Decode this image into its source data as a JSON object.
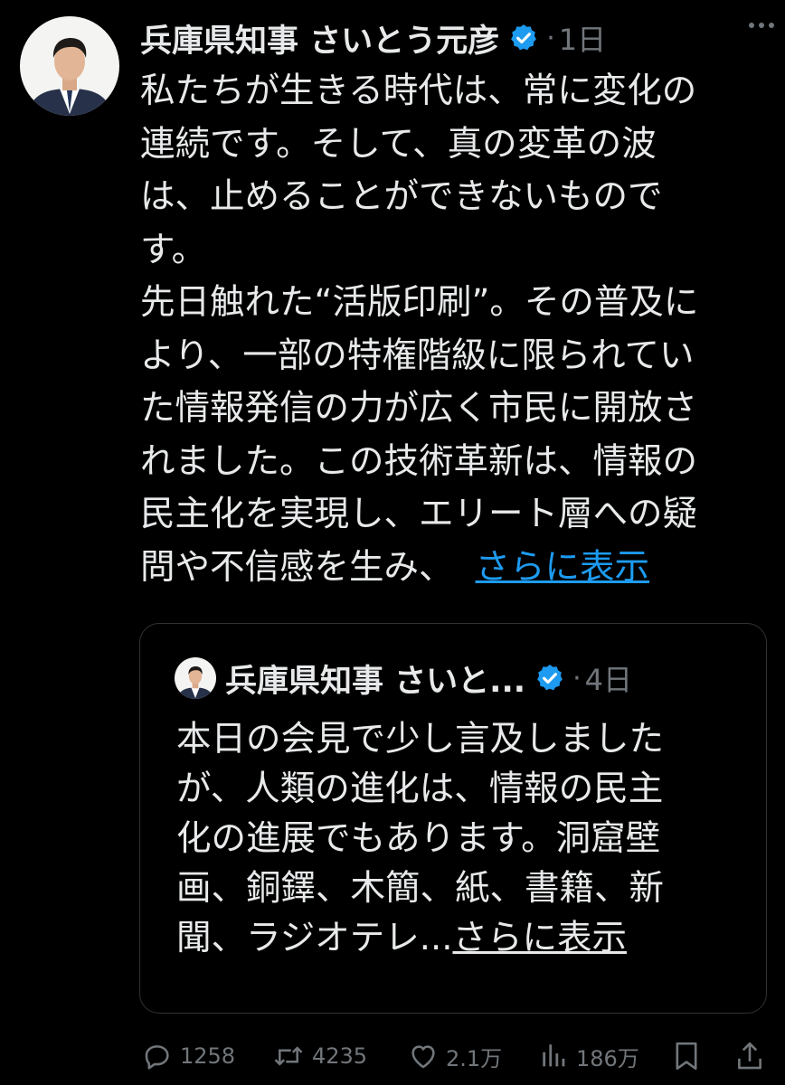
{
  "post": {
    "author": "兵庫県知事 さいとう元彦",
    "time": "1日",
    "dot": "·",
    "paragraph1": [
      "私たちが生きる時代は、常に変化の",
      "連続です。そして、真の変革の波",
      "は、止めることができないもので",
      "す。"
    ],
    "paragraph2": [
      "先日触れた“活版印刷”。その普及に",
      "より、一部の特権階級に限られてい",
      "た情報発信の力が広く市民に開放さ",
      "れました。この技術革新は、情報の",
      "民主化を実現し、エリート層への疑"
    ],
    "last_line": "問や不信感を生み、",
    "show_more": "さらに表示"
  },
  "quote": {
    "author": "兵庫県知事 さいと...",
    "dot": "·",
    "time": "4日",
    "lines": [
      "本日の会見で少し言及しました",
      "が、人類の進化は、情報の民主",
      "化の進展でもあります。洞窟壁",
      "画、銅鐸、木簡、紙、書籍、新"
    ],
    "last_line": "聞、ラジオテレ...",
    "show_more": "さらに表示"
  },
  "actions": {
    "replies": "1258",
    "reposts": "4235",
    "likes": "2.1万",
    "views": "186万"
  },
  "colors": {
    "background": "#000000",
    "text": "#e7e9ea",
    "muted": "#71767b",
    "link": "#1d9bf0",
    "verified": "#1d9bf0",
    "border": "#2f3336"
  },
  "icons": [
    "more-icon",
    "verified-badge-icon",
    "reply-icon",
    "repost-icon",
    "like-icon",
    "views-icon",
    "bookmark-icon",
    "share-icon"
  ]
}
